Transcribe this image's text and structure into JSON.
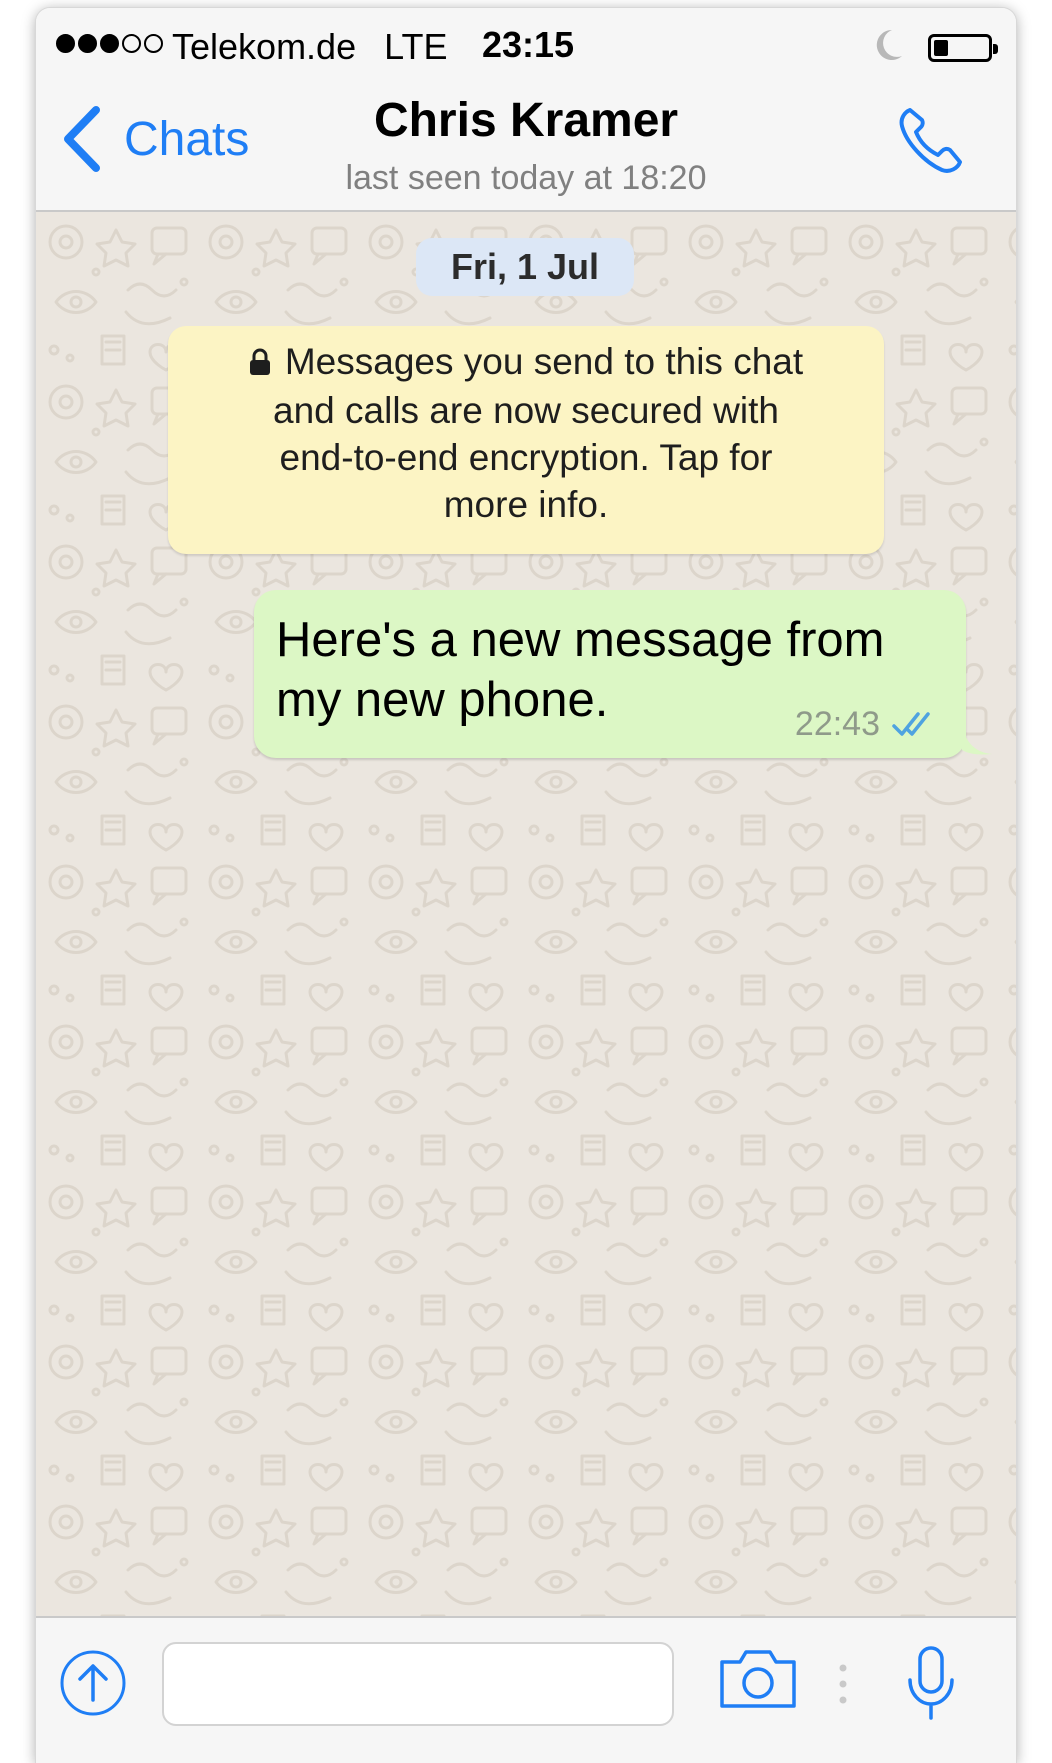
{
  "status_bar": {
    "carrier": "Telekom.de",
    "network": "LTE",
    "time": "23:15",
    "signal_filled": 3,
    "signal_total": 5,
    "battery_level": 0.2,
    "icons": [
      "moon-icon",
      "battery-icon"
    ]
  },
  "nav": {
    "back_label": "Chats",
    "contact_name": "Chris Kramer",
    "last_seen": "last seen today at 18:20",
    "icons": [
      "chevron-left-icon",
      "phone-icon"
    ]
  },
  "chat": {
    "date_label": "Fri, 1 Jul",
    "encryption_notice": {
      "lines": [
        "Messages you send to this chat",
        "and calls are now secured with",
        "end-to-end encryption. Tap for",
        "more info."
      ],
      "icon": "lock-icon"
    },
    "messages": [
      {
        "direction": "outgoing",
        "lines": [
          "Here's a new message from",
          "my new phone."
        ],
        "time": "22:43",
        "status_icon": "double-check-icon",
        "status": "read"
      }
    ]
  },
  "input_bar": {
    "text_value": "",
    "placeholder": "",
    "icons": [
      "upload-icon",
      "camera-icon",
      "mic-icon"
    ]
  },
  "colors": {
    "accent": "#1f7ef5",
    "outgoing_bubble": "#dcf7c5",
    "notice_bubble": "#fcf4c4",
    "date_pill": "#dce7f6",
    "chat_background": "#ebe6df",
    "read_ticks": "#4fa3e0"
  }
}
